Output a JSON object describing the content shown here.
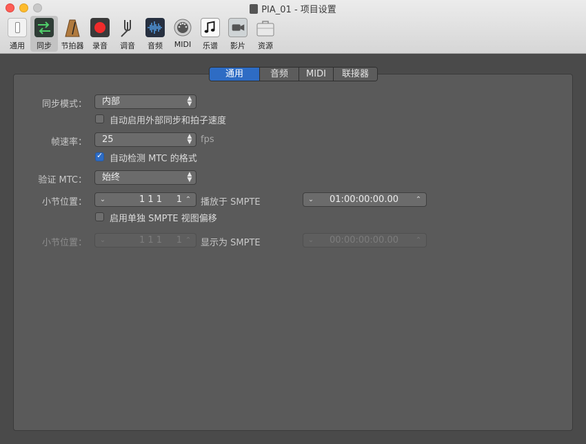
{
  "window": {
    "title": "PIA_01 - 项目设置"
  },
  "toolbar": {
    "items": [
      {
        "label": "通用",
        "icon": "switch-icon"
      },
      {
        "label": "同步",
        "icon": "sync-arrows-icon"
      },
      {
        "label": "节拍器",
        "icon": "metronome-icon"
      },
      {
        "label": "录音",
        "icon": "record-icon"
      },
      {
        "label": "调音",
        "icon": "tuning-fork-icon"
      },
      {
        "label": "音频",
        "icon": "waveform-icon"
      },
      {
        "label": "MIDI",
        "icon": "midi-port-icon"
      },
      {
        "label": "乐谱",
        "icon": "music-note-icon"
      },
      {
        "label": "影片",
        "icon": "video-camera-icon"
      },
      {
        "label": "资源",
        "icon": "briefcase-icon"
      }
    ],
    "selected_index": 1
  },
  "tabs": [
    {
      "label": "通用",
      "selected": true
    },
    {
      "label": "音频",
      "selected": false
    },
    {
      "label": "MIDI",
      "selected": false
    },
    {
      "label": "联接器",
      "selected": false
    }
  ],
  "settings": {
    "sync_mode": {
      "label": "同步模式：",
      "value": "内部"
    },
    "auto_enable_external": {
      "label": "自动启用外部同步和拍子速度",
      "checked": false
    },
    "frame_rate": {
      "label": "帧速率：",
      "value": "25",
      "unit": "fps"
    },
    "auto_detect_mtc": {
      "label": "自动检测 MTC 的格式",
      "checked": true
    },
    "validate_mtc": {
      "label": "验证 MTC：",
      "value": "始终"
    },
    "bar_position_1": {
      "label": "小节位置：",
      "value": "1 1 1     1",
      "mid_text": "播放于 SMPTE",
      "smpte": "01:00:00:00.00"
    },
    "separate_smpte_offset": {
      "label": "启用单独 SMPTE 视图偏移",
      "checked": false
    },
    "bar_position_2": {
      "label": "小节位置：",
      "value": "1 1 1     1",
      "mid_text": "显示为 SMPTE",
      "smpte": "00:00:00:00.00"
    }
  },
  "colors": {
    "accent": "#2e6cc4",
    "panel": "#5a5a5a",
    "background": "#4a4a4a"
  }
}
